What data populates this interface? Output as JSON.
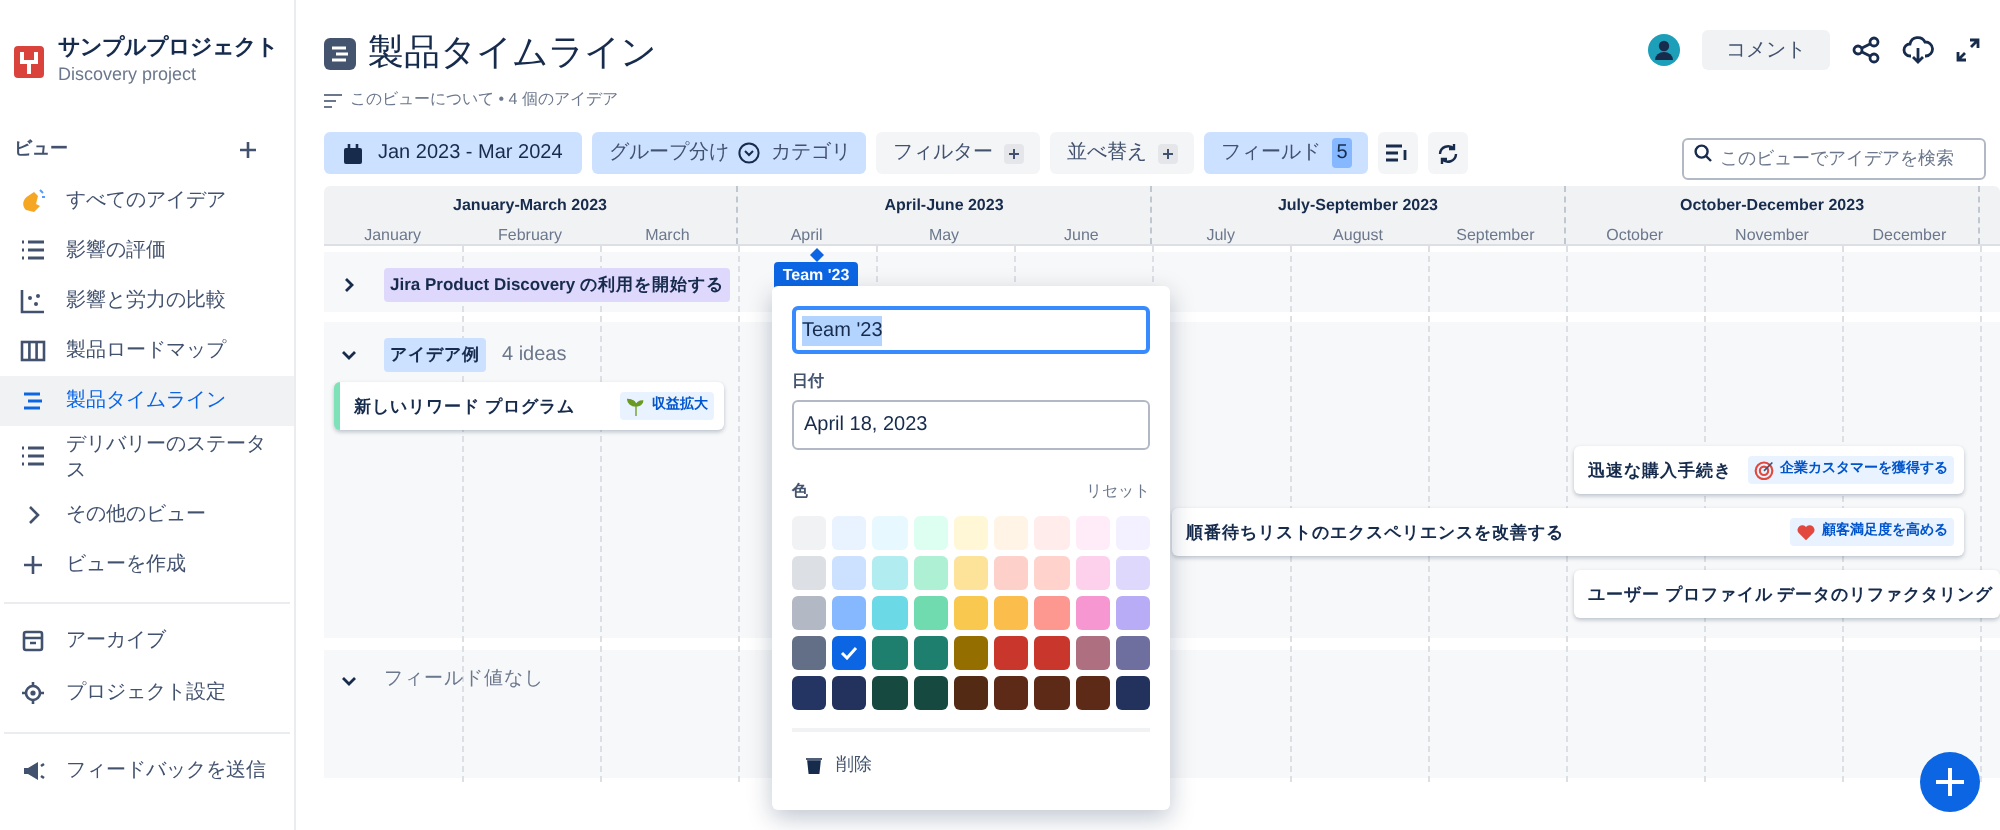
{
  "project": {
    "name": "サンプルプロジェクト",
    "subtitle": "Discovery project"
  },
  "sidebar": {
    "section_title": "ビュー",
    "items": [
      {
        "label": "すべてのアイデア",
        "selected": false
      },
      {
        "label": "影響の評価",
        "selected": false
      },
      {
        "label": "影響と労力の比較",
        "selected": false
      },
      {
        "label": "製品ロードマップ",
        "selected": false
      },
      {
        "label": "製品タイムライン",
        "selected": true
      },
      {
        "label": "デリバリーのステータス",
        "selected": false
      },
      {
        "label": "その他のビュー",
        "selected": false
      },
      {
        "label": "ビューを作成",
        "selected": false
      }
    ],
    "footer_items": [
      {
        "label": "アーカイブ"
      },
      {
        "label": "プロジェクト設定"
      },
      {
        "label": "フィードバックを送信"
      }
    ]
  },
  "header": {
    "title": "製品タイムライン",
    "about": "このビューについて • 4 個のアイデア",
    "comment_button": "コメント"
  },
  "toolbar": {
    "date_range": "Jan 2023 - Mar 2024",
    "group_by": "グループ分け",
    "group_value": "カテゴリ",
    "filter": "フィルター",
    "sort": "並べ替え",
    "fields": "フィールド",
    "fields_count": "5",
    "search": {
      "placeholder": "このビューでアイデアを検索"
    }
  },
  "timeline": {
    "quarters": [
      {
        "label": "January-March 2023",
        "months": [
          "January",
          "February",
          "March"
        ]
      },
      {
        "label": "April-June 2023",
        "months": [
          "April",
          "May",
          "June"
        ]
      },
      {
        "label": "July-September 2023",
        "months": [
          "July",
          "August",
          "September"
        ]
      },
      {
        "label": "October-December 2023",
        "months": [
          "October",
          "November",
          "December"
        ]
      }
    ],
    "groups": [
      {
        "label": "Jira Product Discovery の利用を開始する",
        "expanded": false,
        "color": "#dfd8fd"
      },
      {
        "label": "アイデア例",
        "count": "4 ideas",
        "expanded": true,
        "color": "#cce0ff"
      },
      {
        "label": "フィールド値なし",
        "expanded": true
      }
    ],
    "ideas": [
      {
        "title": "新しいリワード プログラム",
        "tag": "収益拡大",
        "kind": "sprout"
      },
      {
        "title": "迅速な購入手続き",
        "tag": "企業カスタマーを獲得する",
        "kind": "target"
      },
      {
        "title": "順番待ちリストのエクスペリエンスを改善する",
        "tag": "顧客満足度を高める",
        "kind": "heart"
      },
      {
        "title": "ユーザー プロファイル データのリファクタリング"
      }
    ],
    "marker": {
      "label": "Team '23"
    }
  },
  "marker_editor": {
    "name_value": "Team '23",
    "date_label": "日付",
    "date_value": "April 18, 2023",
    "color_label": "色",
    "reset": "リセット",
    "delete": "削除",
    "colors": [
      {
        "color": "#f1f2f4",
        "selected": false
      },
      {
        "color": "#e9f2ff",
        "selected": false
      },
      {
        "color": "#e7f9ff",
        "selected": false
      },
      {
        "color": "#dcfff1",
        "selected": false
      },
      {
        "color": "#fff7d6",
        "selected": false
      },
      {
        "color": "#fff4e5",
        "selected": false
      },
      {
        "color": "#ffeceb",
        "selected": false
      },
      {
        "color": "#ffecf8",
        "selected": false
      },
      {
        "color": "#f3f0ff",
        "selected": false
      },
      {
        "color": "#dcdfe4",
        "selected": false
      },
      {
        "color": "#cce0ff",
        "selected": false
      },
      {
        "color": "#b1ecf1",
        "selected": false
      },
      {
        "color": "#aef0d4",
        "selected": false
      },
      {
        "color": "#fde29a",
        "selected": false
      },
      {
        "color": "#fdd0c9",
        "selected": false
      },
      {
        "color": "#ffd2cc",
        "selected": false
      },
      {
        "color": "#fdd0ec",
        "selected": false
      },
      {
        "color": "#dfd8fd",
        "selected": false
      },
      {
        "color": "#b3b9c4",
        "selected": false
      },
      {
        "color": "#85b8ff",
        "selected": false
      },
      {
        "color": "#6cd9e6",
        "selected": false
      },
      {
        "color": "#6fdbae",
        "selected": false
      },
      {
        "color": "#f9c84e",
        "selected": false
      },
      {
        "color": "#fbbd4b",
        "selected": false
      },
      {
        "color": "#fd9891",
        "selected": false
      },
      {
        "color": "#f797d2",
        "selected": false
      },
      {
        "color": "#b8acf6",
        "selected": false
      },
      {
        "color": "#626f86",
        "selected": false
      },
      {
        "color": "#0c66e4",
        "selected": true
      },
      {
        "color": "#1f7f6f",
        "selected": false
      },
      {
        "color": "#1f7f6f",
        "selected": false
      },
      {
        "color": "#946f00",
        "selected": false
      },
      {
        "color": "#c9372c",
        "selected": false
      },
      {
        "color": "#c9372c",
        "selected": false
      },
      {
        "color": "#ae6f80",
        "selected": false
      },
      {
        "color": "#6e6f9e",
        "selected": false
      },
      {
        "color": "#243563",
        "selected": false
      },
      {
        "color": "#22325c",
        "selected": false
      },
      {
        "color": "#164a40",
        "selected": false
      },
      {
        "color": "#164a40",
        "selected": false
      },
      {
        "color": "#532a13",
        "selected": false
      },
      {
        "color": "#5d2a17",
        "selected": false
      },
      {
        "color": "#5d2a17",
        "selected": false
      },
      {
        "color": "#5d2a17",
        "selected": false
      },
      {
        "color": "#22325c",
        "selected": false
      }
    ]
  }
}
